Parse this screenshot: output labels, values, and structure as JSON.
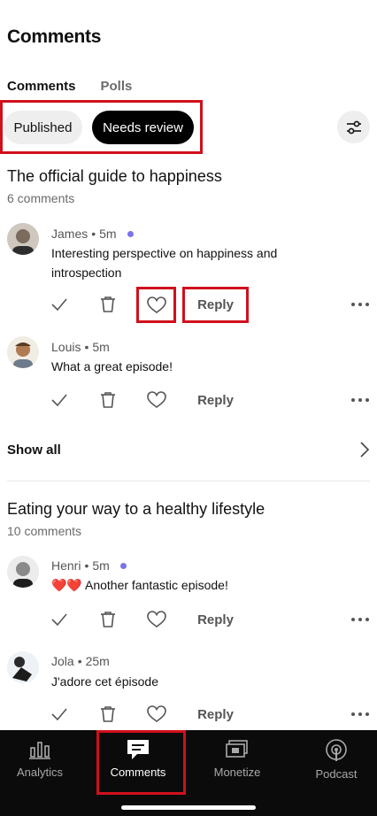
{
  "header": {
    "title": "Comments"
  },
  "tabs": [
    {
      "label": "Comments"
    },
    {
      "label": "Polls"
    }
  ],
  "filters": {
    "published": "Published",
    "needs_review": "Needs review"
  },
  "episodes": [
    {
      "title": "The official guide to happiness",
      "count": "6 comments",
      "comments": [
        {
          "author": "James",
          "time": "5m",
          "new": true,
          "text": "Interesting perspective on happiness and introspection"
        },
        {
          "author": "Louis",
          "time": "5m",
          "new": false,
          "text": "What a great episode!"
        }
      ],
      "show_all": "Show all"
    },
    {
      "title": "Eating your way to a healthy lifestyle",
      "count": "10 comments",
      "comments": [
        {
          "author": "Henri",
          "time": "5m",
          "new": true,
          "text": "❤️❤️ Another fantastic episode!"
        },
        {
          "author": "Jola",
          "time": "25m",
          "new": false,
          "text": "J'adore cet épisode"
        }
      ]
    }
  ],
  "actions": {
    "reply": "Reply"
  },
  "meta_separator": "•",
  "nav": [
    {
      "label": "Analytics",
      "icon": "analytics-icon"
    },
    {
      "label": "Comments",
      "icon": "comment-bubble-icon",
      "active": true
    },
    {
      "label": "Monetize",
      "icon": "monetize-icon"
    },
    {
      "label": "Podcast",
      "icon": "podcast-icon"
    }
  ],
  "colors": {
    "highlight": "#d0101c",
    "new_dot": "#7a74e8",
    "nav_bg": "#0b0b0b"
  }
}
